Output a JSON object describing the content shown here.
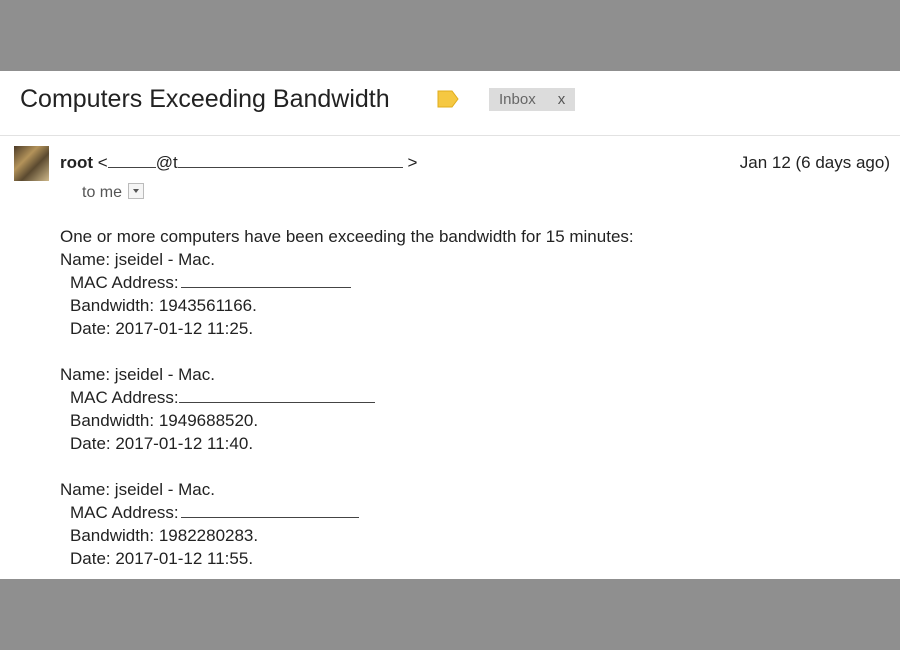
{
  "email": {
    "subject": "Computers Exceeding Bandwidth",
    "label_colors": {
      "tag": "#f5c842"
    },
    "inbox_chip": {
      "label": "Inbox",
      "close": "x"
    },
    "sender": {
      "name": "root",
      "addr_open": "<",
      "addr_at": "@",
      "addr_prefix_after_at": "t",
      "addr_close": ">"
    },
    "date": "Jan 12 (6 days ago)",
    "recipient": "to me",
    "intro": "One or more computers have been exceeding the bandwidth for 15 minutes:",
    "entries": [
      {
        "name": "Name: jseidel - Mac.",
        "mac_label": "MAC Address:",
        "bandwidth": "Bandwidth: 1943561166.",
        "date": "Date: 2017-01-12 11:25."
      },
      {
        "name": "Name: jseidel - Mac.",
        "mac_label": "MAC Address:",
        "bandwidth": "Bandwidth: 1949688520.",
        "date": "Date: 2017-01-12 11:40."
      },
      {
        "name": "Name: jseidel - Mac.",
        "mac_label": "MAC Address:",
        "bandwidth": "Bandwidth: 1982280283.",
        "date": "Date: 2017-01-12 11:55."
      }
    ]
  }
}
